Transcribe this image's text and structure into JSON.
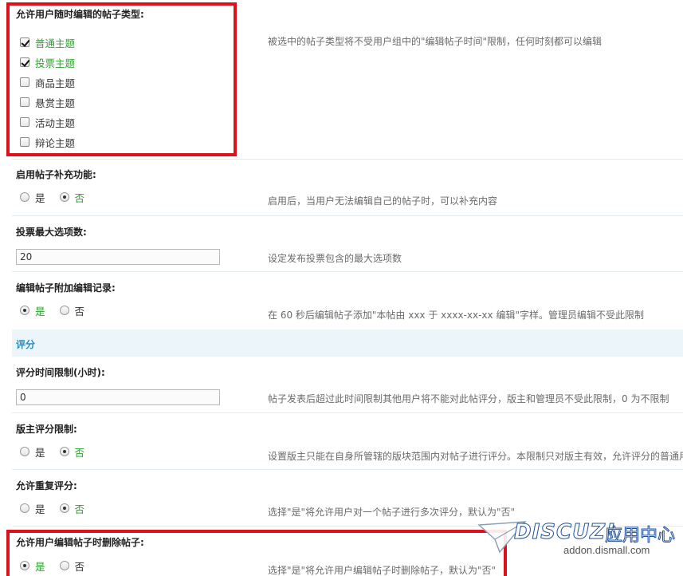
{
  "settings": [
    {
      "title": "允许用户随时编辑的帖子类型:",
      "desc": "被选中的帖子类型将不受用户组中的\"编辑帖子时间\"限制，任何时刻都可以编辑",
      "checkboxes": [
        {
          "label": "普通主题",
          "checked": true
        },
        {
          "label": "投票主题",
          "checked": true
        },
        {
          "label": "商品主题",
          "checked": false
        },
        {
          "label": "悬赏主题",
          "checked": false
        },
        {
          "label": "活动主题",
          "checked": false
        },
        {
          "label": "辩论主题",
          "checked": false
        }
      ]
    },
    {
      "title": "启用帖子补充功能:",
      "desc": "启用后，当用户无法编辑自己的帖子时，可以补充内容",
      "yes": "是",
      "no": "否",
      "selected": "no"
    },
    {
      "title": "投票最大选项数:",
      "desc": "设定发布投票包含的最大选项数",
      "value": "20"
    },
    {
      "title": "编辑帖子附加编辑记录:",
      "desc": "在 60 秒后编辑帖子添加\"本帖由 xxx 于 xxxx-xx-xx 编辑\"字样。管理员编辑不受此限制",
      "yes": "是",
      "no": "否",
      "selected": "yes"
    }
  ],
  "section": {
    "title": "评分"
  },
  "rating": [
    {
      "title": "评分时间限制(小时):",
      "desc": "帖子发表后超过此时间限制其他用户将不能对此帖评分，版主和管理员不受此限制，0 为不限制",
      "value": "0"
    },
    {
      "title": "版主评分限制:",
      "desc": "设置版主只能在自身所管辖的版块范围内对帖子进行评分。本限制只对版主有效，允许评分的普通用",
      "yes": "是",
      "no": "否",
      "selected": "no"
    },
    {
      "title": "允许重复评分:",
      "desc": "选择\"是\"将允许用户对一个帖子进行多次评分，默认为\"否\"",
      "yes": "是",
      "no": "否",
      "selected": "no"
    },
    {
      "title": "允许用户编辑帖子时删除帖子:",
      "desc": "选择\"是\"将允许用户编辑帖子时删除帖子，默认为\"否\"",
      "yes": "是",
      "no": "否",
      "selected": "yes"
    }
  ],
  "watermark": {
    "logo": "DISCUZ!",
    "cn": "应用中心",
    "url": "addon.dismall.com"
  },
  "colors": {
    "selected_label": "#2fa12f",
    "section_title": "#2a8abf",
    "section_bg": "#ecf5fa",
    "highlight_border": "#e0101a"
  }
}
